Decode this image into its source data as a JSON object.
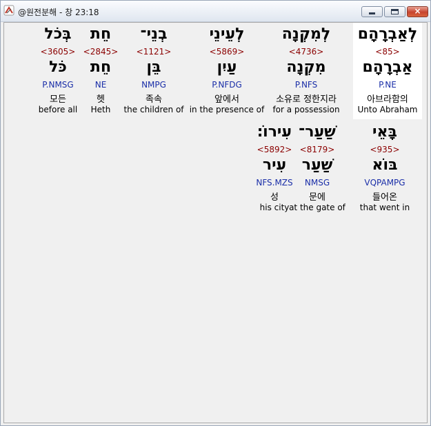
{
  "window": {
    "title": "@원전분해 - 창 23:18",
    "controls": {
      "minimize": "minimize",
      "maximize": "maximize",
      "close": "×"
    }
  },
  "words": [
    {
      "hebrew": "לְאַבְרָהָם",
      "strong": "<85>",
      "lemma": "אַבְרָהָם",
      "morph": "P.NE",
      "korean": "아브라함의",
      "english": "Unto Abraham",
      "selected": true
    },
    {
      "hebrew": "לְמִקְנָה",
      "strong": "<4736>",
      "lemma": "מִקְנָה",
      "morph": "P.NFS",
      "korean": "소유로 정한지라",
      "english": "for a possession"
    },
    {
      "hebrew": "לְעֵינֵי",
      "strong": "<5869>",
      "lemma": "עַיִן",
      "morph": "P.NFDG",
      "korean": "앞에서",
      "english": "in the presence of"
    },
    {
      "hebrew": "בְנֵי־",
      "strong": "<1121>",
      "lemma": "בֵּן",
      "morph": "NMPG",
      "korean": "족속",
      "english": "the children of"
    },
    {
      "hebrew": "חֵת",
      "strong": "<2845>",
      "lemma": "חֵת",
      "morph": "NE",
      "korean": "헷",
      "english": "Heth"
    },
    {
      "hebrew": "בְּכֹל",
      "strong": "<3605>",
      "lemma": "כֹּל",
      "morph": "P.NMSG",
      "korean": "모든",
      "english": "before all"
    },
    {
      "hebrew": "בָּאֵי",
      "strong": "<935>",
      "lemma": "בּוֹא",
      "morph": "VQPAMPG",
      "korean": "들어온",
      "english": "that went in"
    },
    {
      "hebrew": "שַׁעַר־",
      "strong": "<8179>",
      "lemma": "שַׁעַר",
      "morph": "NMSG",
      "korean": "문에",
      "english": "at the gate of"
    },
    {
      "hebrew": "עִירוֹ׃",
      "strong": "<5892>",
      "lemma": "עִיר",
      "morph": "NFS.MZS",
      "korean": "성",
      "english": "his city"
    }
  ]
}
